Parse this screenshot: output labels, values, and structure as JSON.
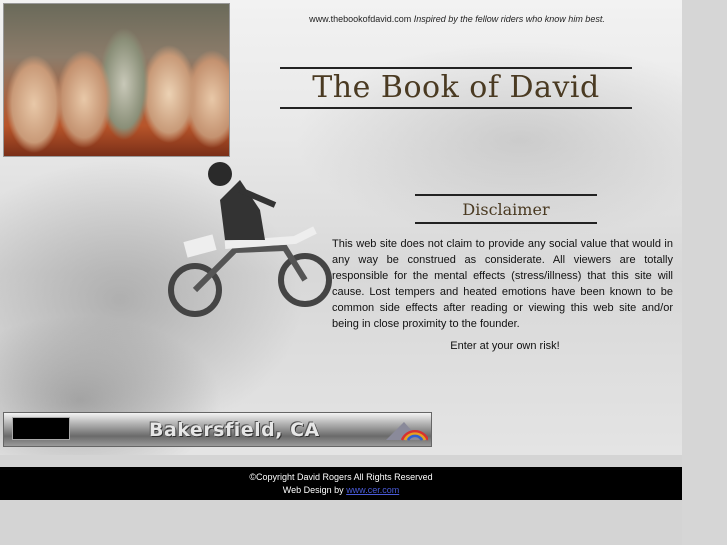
{
  "header": {
    "site_url": "www.thebookofdavid.com",
    "tagline": "Inspired by the fellow riders who know him best."
  },
  "title": "The Book of David",
  "disclaimer": {
    "heading": "Disclaimer",
    "body": "This web site does not claim to provide any social value that would in any way be construed as considerate. All viewers are totally responsible for the mental effects (stress/illness) that this site will cause. Lost tempers and heated emotions have been known to be common side effects after reading or viewing this web site and/or being in close proximity to the founder.",
    "enter": "Enter at your own risk!"
  },
  "banner": {
    "location": "Bakersfield, CA"
  },
  "footer": {
    "copyright": "©Copyright David Rogers All Rights Reserved",
    "design_prefix": "Web Design by",
    "design_link": "www.cer.com"
  },
  "colors": {
    "title": "#4a3a22",
    "footer_bg": "#000000",
    "link": "#4a5bd8"
  }
}
